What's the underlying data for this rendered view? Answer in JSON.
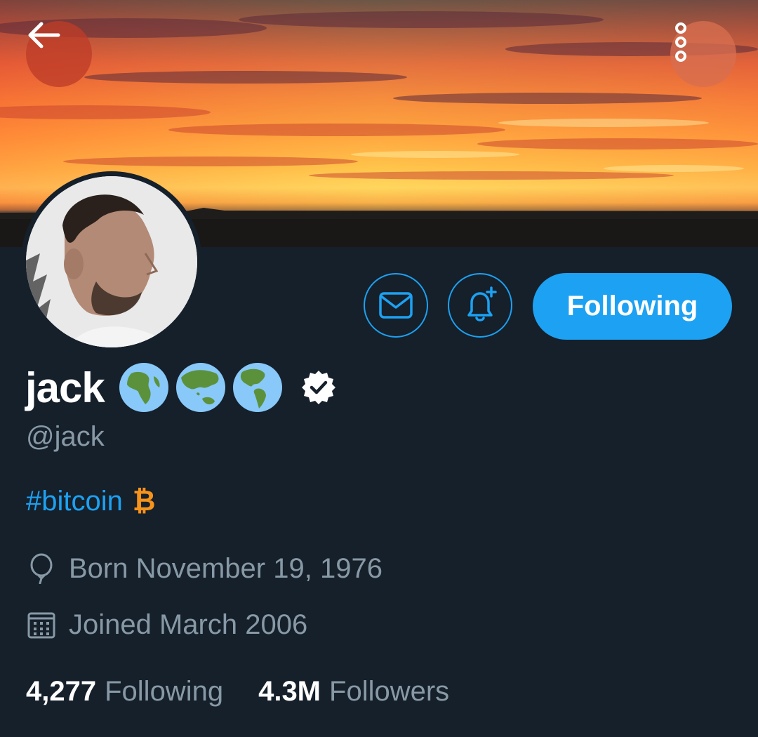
{
  "nav": {
    "back_icon": "arrow-left-icon",
    "more_icon": "vertical-dots-icon"
  },
  "actions": {
    "message_icon": "envelope-icon",
    "notify_icon": "bell-plus-icon",
    "follow_label": "Following"
  },
  "profile": {
    "name": "jack",
    "emoji_icons": [
      "globe-africa-europe-icon",
      "globe-asia-australia-icon",
      "globe-americas-icon"
    ],
    "verified_icon": "verified-badge-icon",
    "handle": "@jack",
    "bio_hashtag": "#bitcoin",
    "bio_symbol": "₿",
    "born": "Born November 19, 1976",
    "joined": "Joined March 2006"
  },
  "stats": {
    "following_count": "4,277",
    "following_label": "Following",
    "followers_count": "4.3M",
    "followers_label": "Followers"
  },
  "colors": {
    "background": "#15202b",
    "accent": "#1da1f2",
    "secondary_text": "#8899a6",
    "bitcoin": "#f7931a"
  }
}
